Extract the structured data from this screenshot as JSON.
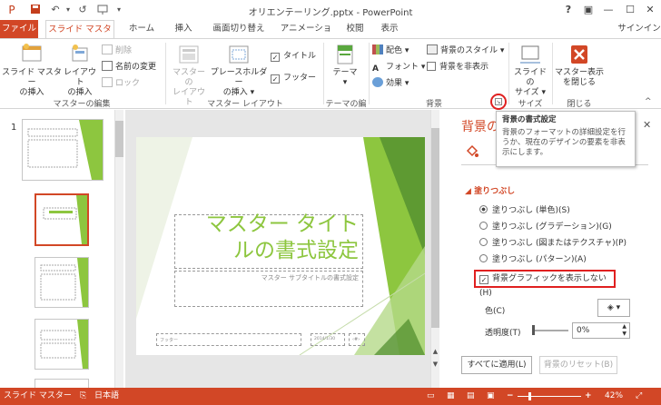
{
  "window": {
    "title": "オリエンテーリング.pptx - PowerPoint",
    "help": "?",
    "ribbon_display": "▣",
    "minimize": "—",
    "restore": "☐",
    "close": "✕"
  },
  "tabs": [
    "ファイル",
    "スライド マスター",
    "ホーム",
    "挿入",
    "画面切り替え",
    "アニメーション",
    "校閲",
    "表示"
  ],
  "signin": "サインイン",
  "ribbon": {
    "insert_master": "スライド マスター\nの挿入",
    "insert_layout": "レイアウト\nの挿入",
    "delete": "削除",
    "rename": "名前の変更",
    "lock": "ロック",
    "group_edit_master": "マスターの編集",
    "master_layout": "マスターの\nレイアウト",
    "insert_placeholder": "プレースホルダー\nの挿入 ▾",
    "title_chk": "タイトル",
    "footer_chk": "フッター",
    "group_master_layout": "マスター レイアウト",
    "theme": "テーマ\n▾",
    "group_edit_theme": "テーマの編集",
    "colors": "配色 ▾",
    "fonts": "フォント ▾",
    "effects": "効果 ▾",
    "bg_style": "背景のスタイル ▾",
    "hide_bg": "背景を非表示",
    "group_background": "背景",
    "slide_size": "スライドの\nサイズ ▾",
    "group_size": "サイズ",
    "close_master": "マスター表示\nを閉じる",
    "group_close": "閉じる",
    "collapse": "^"
  },
  "tooltip": {
    "title": "背景の書式設定",
    "body": "背景のフォーマットの詳細設定を行うか、現在のデザインの要素を非表示にします。"
  },
  "thumbs": {
    "number": "1"
  },
  "slide": {
    "title": "マスター タイトルの書式設定",
    "subtitle": "マスター サブタイトルの書式設定",
    "footer": "フッター",
    "date": "2014/1/30",
    "num": "‹#›"
  },
  "pane": {
    "title": "背景の書式設定",
    "close": "✕",
    "section": "塗りつぶし",
    "options": [
      "塗りつぶし (単色)(S)",
      "塗りつぶし (グラデーション)(G)",
      "塗りつぶし (図またはテクスチャ)(P)",
      "塗りつぶし (パターン)(A)"
    ],
    "hide_graphics": "背景グラフィックを表示しない(H)",
    "color_label": "色(C)",
    "transparency_label": "透明度(T)",
    "transparency_value": "0%",
    "apply_all": "すべてに適用(L)",
    "reset": "背景のリセット(B)"
  },
  "status": {
    "view": "スライド マスター",
    "lang": "日本語",
    "zoom": "42%",
    "minus": "−",
    "plus": "+"
  },
  "colors": {
    "accent": "#d24726",
    "green": "#8dc63f",
    "highlight": "#e02020"
  }
}
